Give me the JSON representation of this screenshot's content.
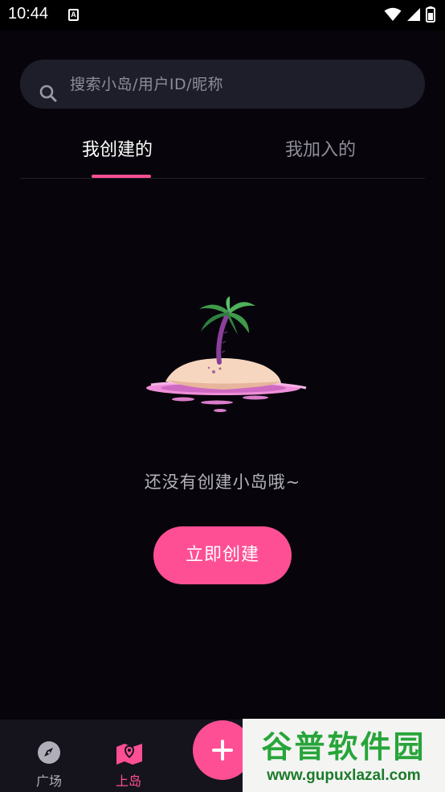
{
  "status_bar": {
    "time": "10:44",
    "notification_letter": "A"
  },
  "search": {
    "placeholder": "搜索小岛/用户ID/昵称"
  },
  "tabs": [
    {
      "label": "我创建的",
      "active": true
    },
    {
      "label": "我加入的",
      "active": false
    }
  ],
  "empty_state": {
    "message": "还没有创建小岛哦~",
    "button_label": "立即创建"
  },
  "bottom_nav": {
    "items": [
      {
        "label": "广场",
        "icon": "compass-icon",
        "active": false
      },
      {
        "label": "上岛",
        "icon": "map-pin-icon",
        "active": true
      }
    ],
    "fab_icon": "plus-icon"
  },
  "watermark": {
    "title": "谷普软件园",
    "url": "www.gupuxlazal.com"
  },
  "colors": {
    "accent": "#ff4f94",
    "background": "#07050b",
    "search_bg": "#1e1d2a",
    "nav_bg": "#15141c"
  }
}
